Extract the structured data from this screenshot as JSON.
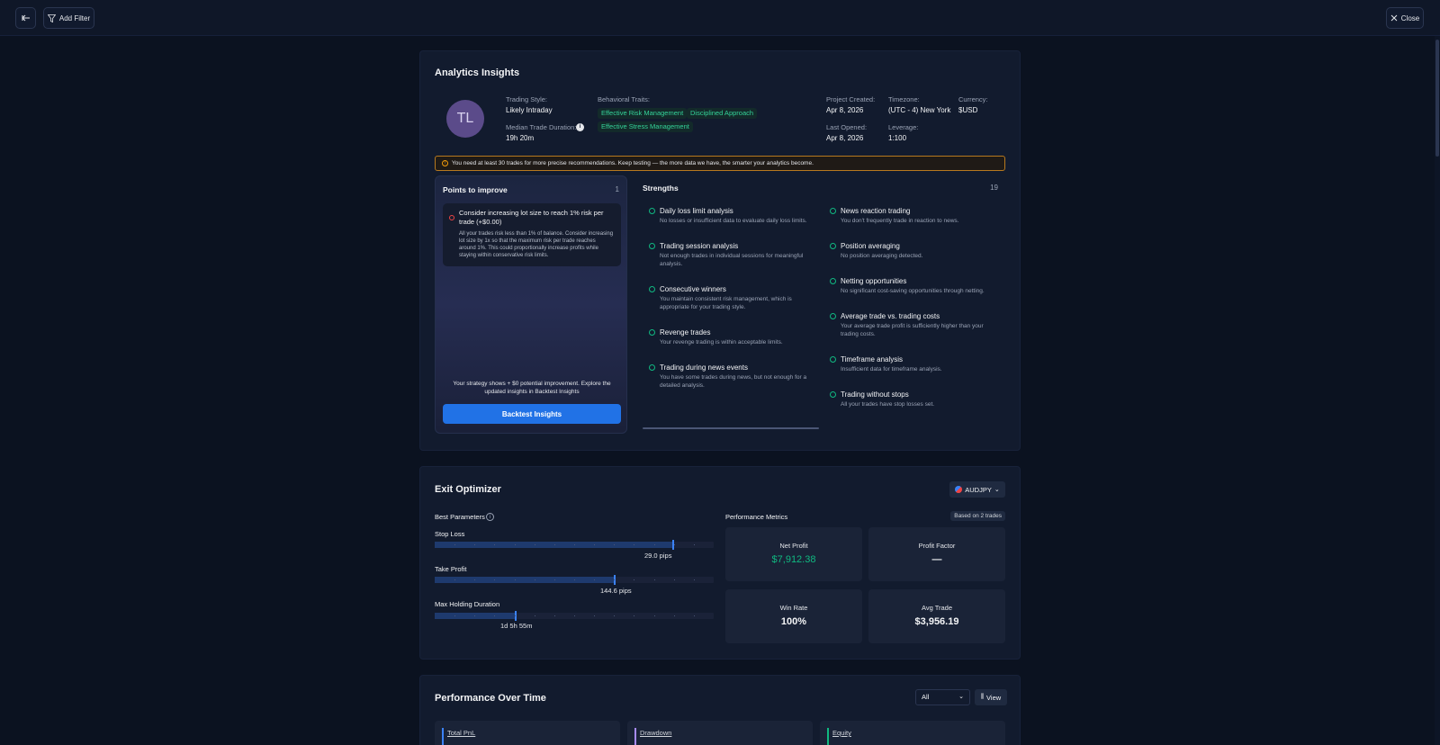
{
  "topbar": {
    "add_filter_label": "Add Filter",
    "close_label": "Close"
  },
  "analytics": {
    "title": "Analytics Insights",
    "avatar_initials": "TL",
    "trading_style_label": "Trading Style:",
    "trading_style_value": "Likely Intraday",
    "median_duration_label": "Median Trade Duration:",
    "median_duration_value": "19h 20m",
    "behavioral_label": "Behavioral Traits:",
    "traits": [
      "Effective Risk Management",
      "Disciplined Approach",
      "Effective Stress Management"
    ],
    "project_created_label": "Project Created:",
    "project_created_value": "Apr 8, 2026",
    "timezone_label": "Timezone:",
    "timezone_value": "(UTC - 4) New York",
    "currency_label": "Currency:",
    "currency_value": "$USD",
    "last_opened_label": "Last Opened:",
    "last_opened_value": "Apr 8, 2026",
    "leverage_label": "Leverage:",
    "leverage_value": "1:100",
    "warning": "You need at least 30 trades for more precise recommendations. Keep testing — the more data we have, the smarter your analytics become.",
    "points_title": "Points to improve",
    "points_count": "1",
    "point_title": "Consider increasing lot size to reach 1% risk per trade (+$0.00)",
    "point_desc": "All your trades risk less than 1% of balance. Consider increasing lot size by 1x so that the maximum risk per trade reaches around 1%. This could proportionally increase profits while staying within conservative risk limits.",
    "strategy_note": "Your strategy shows + $0 potential improvement. Explore the updated insights in Backtest Insights",
    "backtest_button": "Backtest Insights",
    "strengths_title": "Strengths",
    "strengths_count": "19",
    "strengths_left": [
      {
        "title": "Daily loss limit analysis",
        "desc": "No losses or insufficient data to evaluate daily loss limits."
      },
      {
        "title": "Trading session analysis",
        "desc": "Not enough trades in individual sessions for meaningful analysis."
      },
      {
        "title": "Consecutive winners",
        "desc": "You maintain consistent risk management, which is appropriate for your trading style."
      },
      {
        "title": "Revenge trades",
        "desc": "Your revenge trading is within acceptable limits."
      },
      {
        "title": "Trading during news events",
        "desc": "You have some trades during news, but not enough for a detailed analysis."
      }
    ],
    "strengths_right": [
      {
        "title": "News reaction trading",
        "desc": "You don't frequently trade in reaction to news."
      },
      {
        "title": "Position averaging",
        "desc": "No position averaging detected."
      },
      {
        "title": "Netting opportunities",
        "desc": "No significant cost-saving opportunities through netting."
      },
      {
        "title": "Average trade vs. trading costs",
        "desc": "Your average trade profit is sufficiently higher than your trading costs."
      },
      {
        "title": "Timeframe analysis",
        "desc": "Insufficient data for timeframe analysis."
      },
      {
        "title": "Trading without stops",
        "desc": "All your trades have stop losses set."
      }
    ]
  },
  "exit_optimizer": {
    "title": "Exit Optimizer",
    "symbol": "AUDJPY",
    "best_params_label": "Best Parameters",
    "stop_loss_label": "Stop Loss",
    "stop_loss_value": "29.0 pips",
    "stop_loss_fraction": 0.855,
    "take_profit_label": "Take Profit",
    "take_profit_value": "144.6 pips",
    "take_profit_fraction": 0.645,
    "max_hold_label": "Max Holding Duration",
    "max_hold_value": "1d 5h 55m",
    "max_hold_fraction": 0.29,
    "perf_label": "Performance Metrics",
    "based_on": "Based on 2 trades",
    "metrics": [
      {
        "label": "Net Profit",
        "value": "$7,912.38",
        "color": "#10b981"
      },
      {
        "label": "Profit Factor",
        "value": "—",
        "color": "#f3f4f6"
      },
      {
        "label": "Win Rate",
        "value": "100%",
        "color": "#f3f4f6"
      },
      {
        "label": "Avg Trade",
        "value": "$3,956.19",
        "color": "#f3f4f6"
      }
    ]
  },
  "performance": {
    "title": "Performance Over Time",
    "range_value": "All",
    "view_label": "View",
    "cards": [
      {
        "label": "Total PnL",
        "accent": "#3b82f6"
      },
      {
        "label": "Drawdown",
        "accent": "#a78bfa"
      },
      {
        "label": "Equity",
        "accent": "#10b981"
      }
    ]
  }
}
